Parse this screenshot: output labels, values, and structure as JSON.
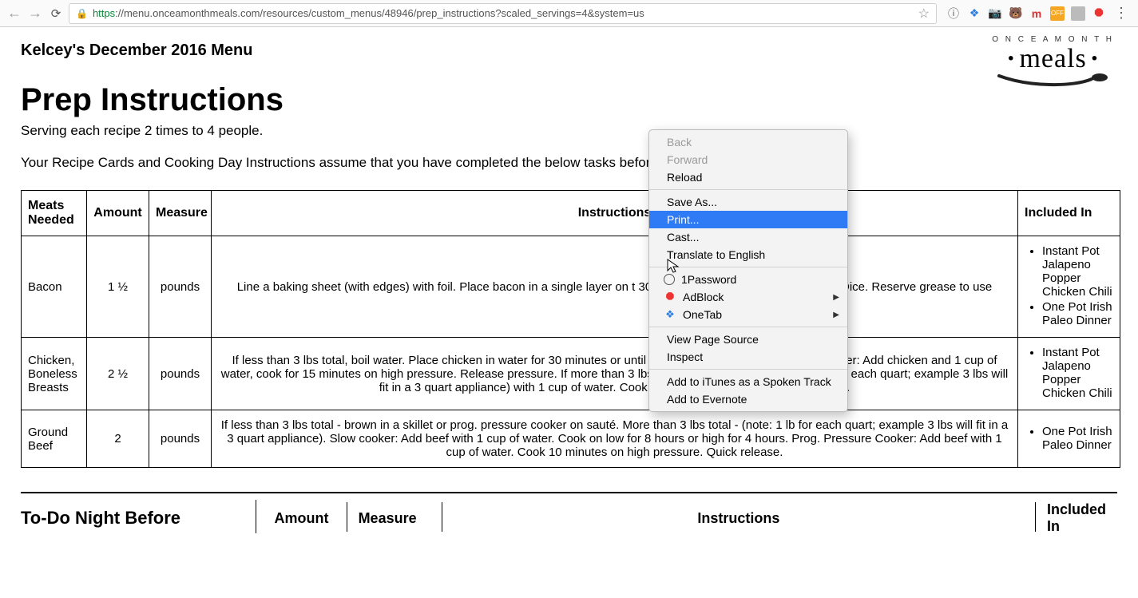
{
  "browser": {
    "url_scheme": "https",
    "url_rest": "://menu.onceamonthmeals.com/resources/custom_menus/48946/prep_instructions?scaled_servings=4&system=us",
    "extensions": [
      "info",
      "onetab",
      "camera",
      "bear",
      "mred",
      "evernote",
      "grey",
      "adblock"
    ]
  },
  "logo": {
    "arc": "O N C E  A  M O N T H",
    "word": "meals"
  },
  "page": {
    "menu_title": "Kelcey's December 2016 Menu",
    "heading": "Prep Instructions",
    "serving_line": "Serving each recipe 2 times to 4 people.",
    "assume_line": "Your Recipe Cards and Cooking Day Instructions assume that you have completed the below tasks before you st",
    "headers": {
      "c1": "Meats Needed",
      "c2": "Amount",
      "c3": "Measure",
      "c4": "Instructions",
      "c5": "Included In"
    },
    "rows": [
      {
        "meat": "Bacon",
        "amount": "1 ½",
        "measure": "pounds",
        "instr": "Line a baking sheet (with edges) with foil. Place bacon in a single layer on t                                         30 minutes or until desired doneness. Dice. Reserve grease to use",
        "included": [
          "Instant Pot Jalapeno Popper Chicken Chili",
          "One Pot Irish Paleo Dinner"
        ]
      },
      {
        "meat": "Chicken, Boneless Breasts",
        "amount": "2 ½",
        "measure": "pounds",
        "instr": "If less than 3 lbs total, boil water. Place chicken in water for 30 minutes or until cooked through. Prog. pressure cooker: Add chicken and 1 cup of water, cook for 15 minutes on high pressure. Release pressure. If more than 3 lbs total, place in a slow cooker (1 lb for each quart; example 3 lbs will fit in a 3 quart appliance) with 1 cup of water. Cook on low for 8 hours or high for 4 hours.",
        "included": [
          "Instant Pot Jalapeno Popper Chicken Chili"
        ]
      },
      {
        "meat": "Ground Beef",
        "amount": "2",
        "measure": "pounds",
        "instr": "If less than 3 lbs total - brown in a skillet or prog. pressure cooker on sauté. More than 3 lbs total - (note: 1 lb for each quart; example 3 lbs will fit in a 3 quart appliance). Slow cooker: Add beef with 1 cup of water. Cook on low for 8 hours or high for 4 hours. Prog. Pressure Cooker: Add beef with 1 cup of water. Cook 10 minutes on high pressure. Quick release.",
        "included": [
          "One Pot Irish Paleo Dinner"
        ]
      }
    ],
    "night_header": {
      "title": "To-Do Night Before",
      "c2": "Amount",
      "c3": "Measure",
      "c4": "Instructions",
      "c5": "Included In"
    }
  },
  "context_menu": {
    "groups": [
      [
        {
          "label": "Back",
          "state": "disabled"
        },
        {
          "label": "Forward",
          "state": "disabled"
        },
        {
          "label": "Reload"
        }
      ],
      [
        {
          "label": "Save As..."
        },
        {
          "label": "Print...",
          "state": "hl"
        },
        {
          "label": "Cast..."
        },
        {
          "label": "Translate to English"
        }
      ],
      [
        {
          "label": "1Password",
          "icon": "onepw"
        },
        {
          "label": "AdBlock",
          "icon": "adblock",
          "sub": true
        },
        {
          "label": "OneTab",
          "icon": "onetab",
          "sub": true
        }
      ],
      [
        {
          "label": "View Page Source"
        },
        {
          "label": "Inspect"
        }
      ],
      [
        {
          "label": "Add to iTunes as a Spoken Track"
        },
        {
          "label": "Add to Evernote"
        }
      ]
    ]
  }
}
